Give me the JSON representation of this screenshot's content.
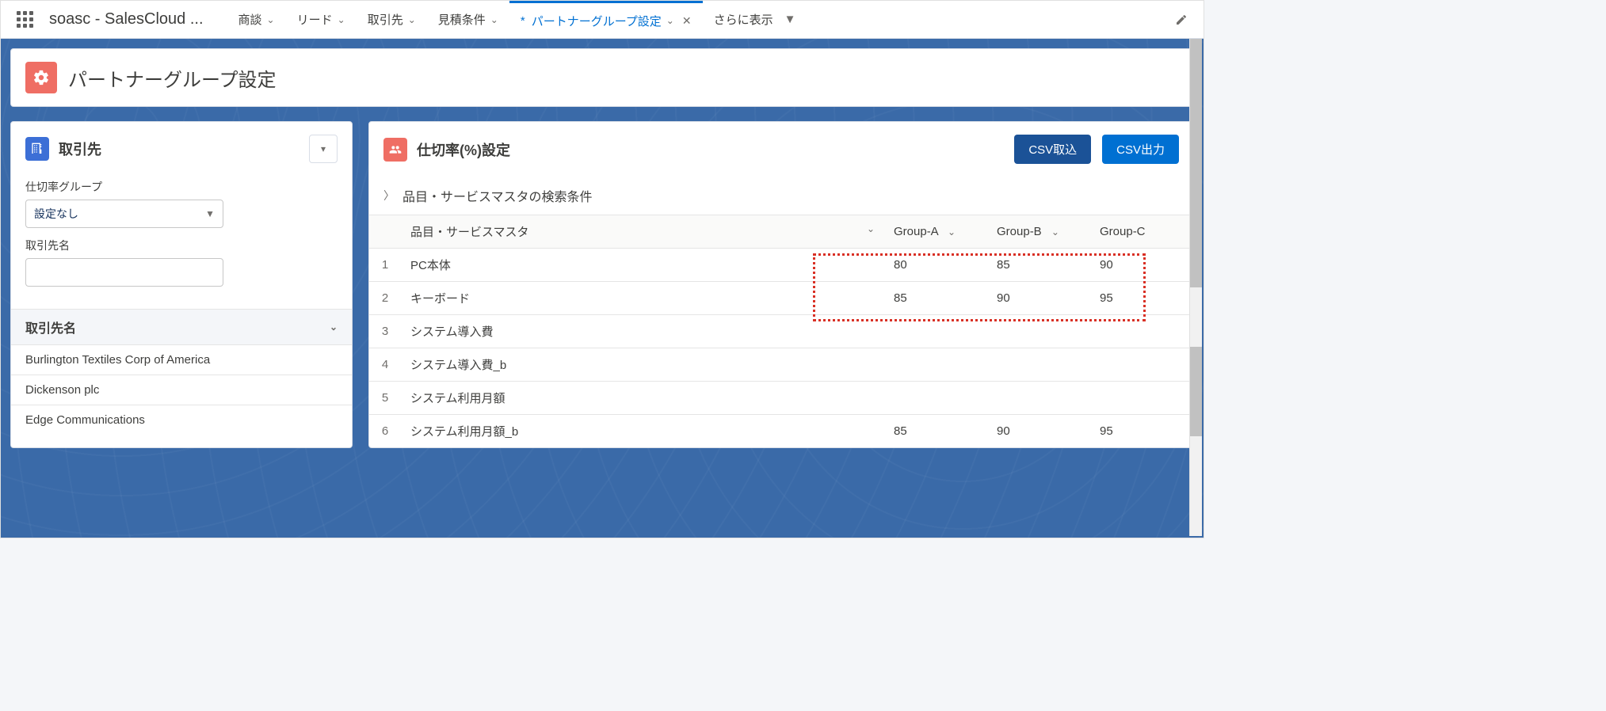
{
  "app_name": "soasc - SalesCloud ...",
  "nav": {
    "items": [
      {
        "label": "商談"
      },
      {
        "label": "リード"
      },
      {
        "label": "取引先"
      },
      {
        "label": "見積条件"
      }
    ],
    "active": {
      "prefix": "*",
      "label": "パートナーグループ設定"
    },
    "more": "さらに表示"
  },
  "page_title": "パートナーグループ設定",
  "left": {
    "title": "取引先",
    "group_label": "仕切率グループ",
    "group_value": "設定なし",
    "account_label": "取引先名",
    "list_header": "取引先名",
    "rows": [
      "Burlington Textiles Corp of America",
      "Dickenson plc",
      "Edge Communications"
    ]
  },
  "right": {
    "title": "仕切率(%)設定",
    "btn_import": "CSV取込",
    "btn_export": "CSV出力",
    "search_label": "品目・サービスマスタの検索条件",
    "columns": {
      "item": "品目・サービスマスタ",
      "g1": "Group-A",
      "g2": "Group-B",
      "g3": "Group-C"
    },
    "rows": [
      {
        "idx": "1",
        "name": "PC本体",
        "g1": "80",
        "g2": "85",
        "g3": "90"
      },
      {
        "idx": "2",
        "name": "キーボード",
        "g1": "85",
        "g2": "90",
        "g3": "95"
      },
      {
        "idx": "3",
        "name": "システム導入費",
        "g1": "",
        "g2": "",
        "g3": ""
      },
      {
        "idx": "4",
        "name": "システム導入費_b",
        "g1": "",
        "g2": "",
        "g3": ""
      },
      {
        "idx": "5",
        "name": "システム利用月額",
        "g1": "",
        "g2": "",
        "g3": ""
      },
      {
        "idx": "6",
        "name": "システム利用月額_b",
        "g1": "85",
        "g2": "90",
        "g3": "95"
      }
    ]
  }
}
